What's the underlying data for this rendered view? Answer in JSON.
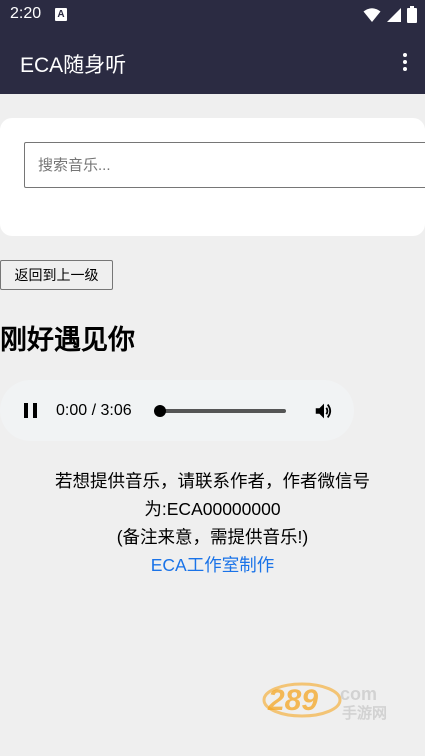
{
  "status_bar": {
    "time": "2:20",
    "notif_letter": "A"
  },
  "app_bar": {
    "title": "ECA随身听",
    "overflow_icon": "more-vert-icon"
  },
  "search": {
    "placeholder": "搜索音乐...",
    "value": ""
  },
  "back_button": {
    "label": "返回到上一级"
  },
  "song": {
    "title": "刚好遇见你"
  },
  "player": {
    "time_display": "0:00 / 3:06",
    "progress": 0,
    "state": "playing"
  },
  "info": {
    "line1": "若想提供音乐，请联系作者，作者微信号",
    "line2": "为:ECA00000000",
    "line3": "(备注来意，需提供音乐!)",
    "link": "ECA工作室制作"
  },
  "watermark": {
    "number": "289",
    "suffix": "com",
    "subtitle": "手游网"
  },
  "colors": {
    "app_bar": "#2b2b42",
    "background": "#efefef",
    "link": "#1a73e8"
  }
}
